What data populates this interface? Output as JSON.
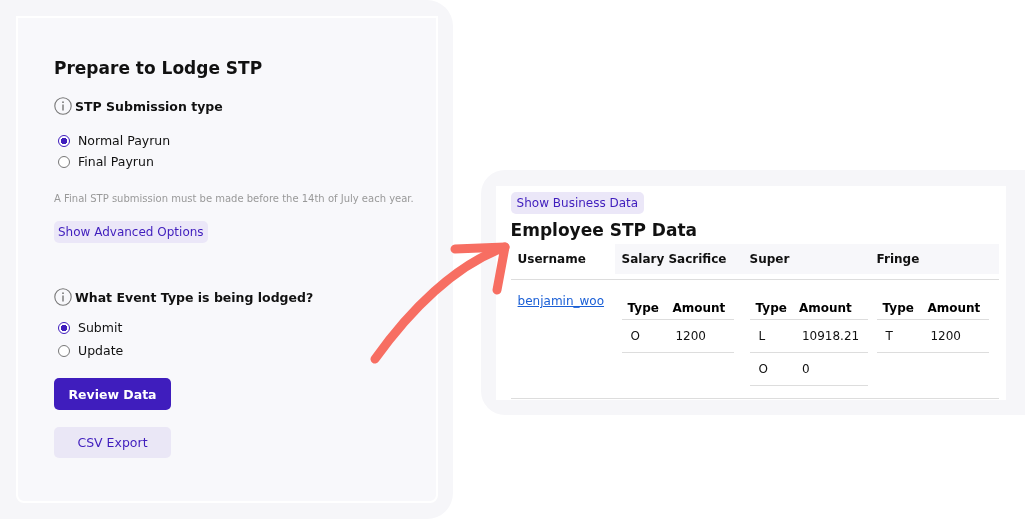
{
  "form": {
    "title": "Prepare to Lodge STP",
    "sections": [
      {
        "label": "STP Submission type",
        "options": [
          {
            "label": "Normal Payrun",
            "selected": true
          },
          {
            "label": "Final Payrun",
            "selected": false
          }
        ],
        "note": "A Final STP submission must be made before the 14th of July each year.",
        "link_button": "Show Advanced Options"
      },
      {
        "label": "What Event Type is being lodged?",
        "options": [
          {
            "label": "Submit",
            "selected": true
          },
          {
            "label": "Update",
            "selected": false
          }
        ]
      }
    ],
    "buttons": [
      {
        "label": "Review Data",
        "kind": "primary"
      },
      {
        "label": "CSV Export",
        "kind": "secondary"
      }
    ]
  },
  "employee_data": {
    "toggle_button": "Show Business Data",
    "title": "Employee STP Data",
    "columns": [
      "Username",
      "Salary Sacrifice",
      "Super",
      "Fringe"
    ],
    "rows": [
      {
        "username": "benjamin_woo",
        "groups": [
          {
            "columns": [
              "Type",
              "Amount"
            ],
            "rows": [
              [
                "O",
                "1200"
              ]
            ]
          },
          {
            "columns": [
              "Type",
              "Amount"
            ],
            "rows": [
              [
                "L",
                "10918.21"
              ],
              [
                "O",
                "0"
              ]
            ]
          },
          {
            "columns": [
              "Type",
              "Amount"
            ],
            "rows": [
              [
                "T",
                "1200"
              ]
            ]
          }
        ]
      }
    ]
  }
}
